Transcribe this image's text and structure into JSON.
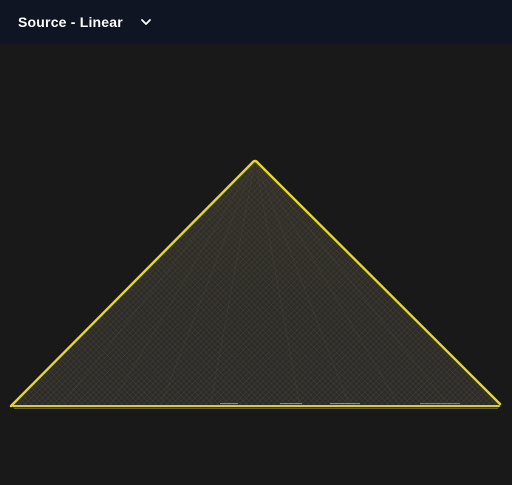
{
  "header": {
    "source_label": "Source - Linear",
    "chevron_icon": "chevron-down-icon"
  },
  "viewport": {
    "background_color": "#191919",
    "topbar_color": "#0f1522",
    "accent_color": "#e5d82a",
    "mesh_color": "#7a7462"
  }
}
